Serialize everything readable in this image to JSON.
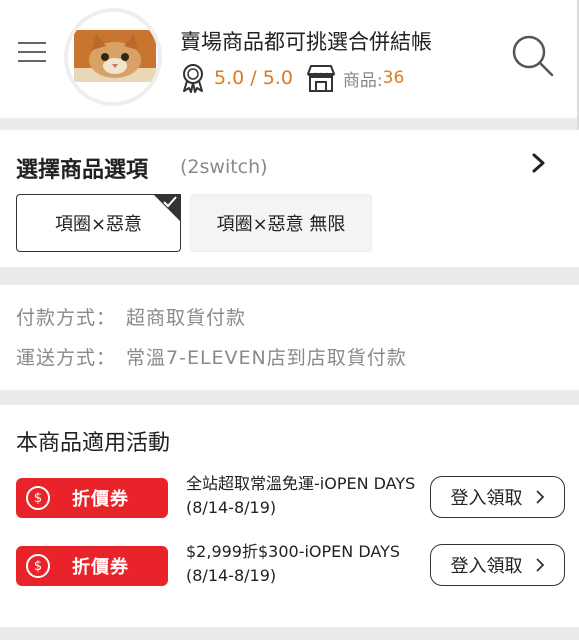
{
  "header": {
    "shop_title": "賣場商品都可挑選合併結帳",
    "rating": "5.0 / 5.0",
    "product_count_label": "商品:",
    "product_count": "36",
    "accent_color": "#e07a1f"
  },
  "options": {
    "title": "選擇商品選項",
    "subtitle": "(2switch)",
    "chips": [
      {
        "label": "項圈×惡意",
        "selected": true
      },
      {
        "label": "項圈×惡意 無限",
        "selected": false
      }
    ]
  },
  "payment": {
    "pay_label": "付款方式：",
    "pay_value": "超商取貨付款",
    "ship_label": "運送方式：",
    "ship_value": "常溫7-ELEVEN店到店取貨付款"
  },
  "promotions": {
    "title": "本商品適用活動",
    "badge_color": "#e8242a",
    "items": [
      {
        "badge_symbol": "$",
        "badge_label": "折價券",
        "text": "全站超取常溫免運-iOPEN DAYS(8/14-8/19)",
        "action": "登入領取"
      },
      {
        "badge_symbol": "$",
        "badge_label": "折價券",
        "text": "$2,999折$300-iOPEN DAYS (8/14-8/19)",
        "action": "登入領取"
      }
    ]
  }
}
